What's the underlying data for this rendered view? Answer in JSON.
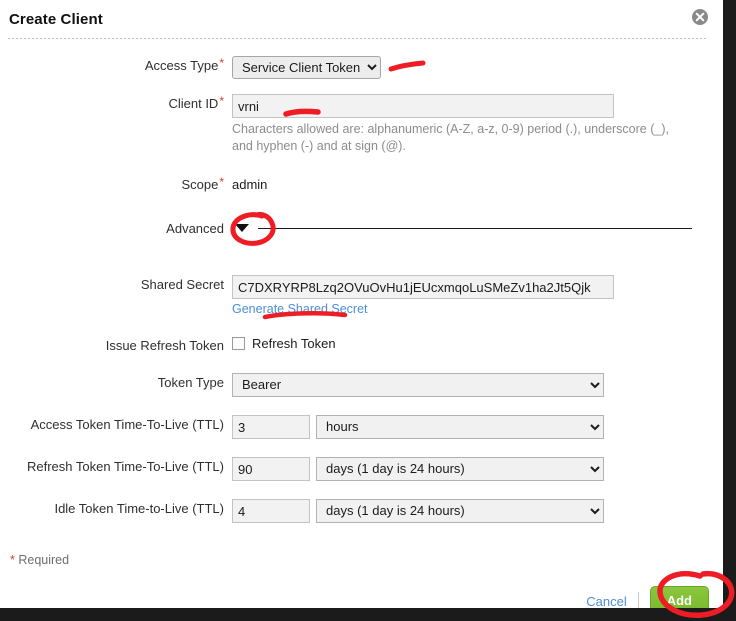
{
  "dialog": {
    "title": "Create Client",
    "close_icon": "close-circle-icon"
  },
  "form": {
    "access_type": {
      "label": "Access Type",
      "required_marker": "*",
      "value": "Service Client Token",
      "options": [
        "Service Client Token"
      ]
    },
    "client_id": {
      "label": "Client ID",
      "required_marker": "*",
      "value": "vrni",
      "placeholder": "",
      "help": "Characters allowed are: alphanumeric (A-Z, a-z, 0-9) period (.), underscore (_), and hyphen (-) and at sign (@)."
    },
    "scope": {
      "label": "Scope",
      "required_marker": "*",
      "value": "admin"
    },
    "advanced": {
      "label": "Advanced",
      "caret_icon": "caret-down-icon",
      "expanded": true
    },
    "shared_secret": {
      "label": "Shared Secret",
      "value": "C7DXRYRP8Lzq2OVuOvHu1jEUcxmqoLuSMeZv1ha2Jt5Qjk",
      "placeholder": "",
      "generate_link": "Generate Shared Secret"
    },
    "issue_refresh_token": {
      "label": "Issue Refresh Token",
      "checkbox_label": "Refresh Token",
      "checked": false
    },
    "token_type": {
      "label": "Token Type",
      "value": "Bearer",
      "options": [
        "Bearer"
      ]
    },
    "access_ttl": {
      "label": "Access Token Time-To-Live (TTL)",
      "value": "3",
      "unit": "hours",
      "unit_options": [
        "hours"
      ]
    },
    "refresh_ttl": {
      "label": "Refresh Token Time-To-Live (TTL)",
      "value": "90",
      "unit": "days (1 day is 24 hours)",
      "unit_options": [
        "days (1 day is 24 hours)"
      ]
    },
    "idle_ttl": {
      "label": "Idle Token Time-to-Live (TTL)",
      "value": "4",
      "unit": "days (1 day is 24 hours)",
      "unit_options": [
        "days (1 day is 24 hours)"
      ]
    }
  },
  "footer": {
    "required_star": "*",
    "required_text": "Required",
    "cancel_label": "Cancel",
    "add_label": "Add"
  },
  "colors": {
    "required_red": "#d43f3a",
    "link_blue": "#4a90d9",
    "add_green": "#8cc63e",
    "annotation_red": "#ee1c24",
    "help_gray": "#8c8c8c"
  },
  "annotations": {
    "access_type_underline": "red-stroke-access-type",
    "client_id_underline": "red-stroke-client-id",
    "advanced_caret_circle": "red-circle-advanced-caret",
    "generate_secret_underline": "red-stroke-generate-secret",
    "add_button_circle": "red-circle-add-button"
  }
}
